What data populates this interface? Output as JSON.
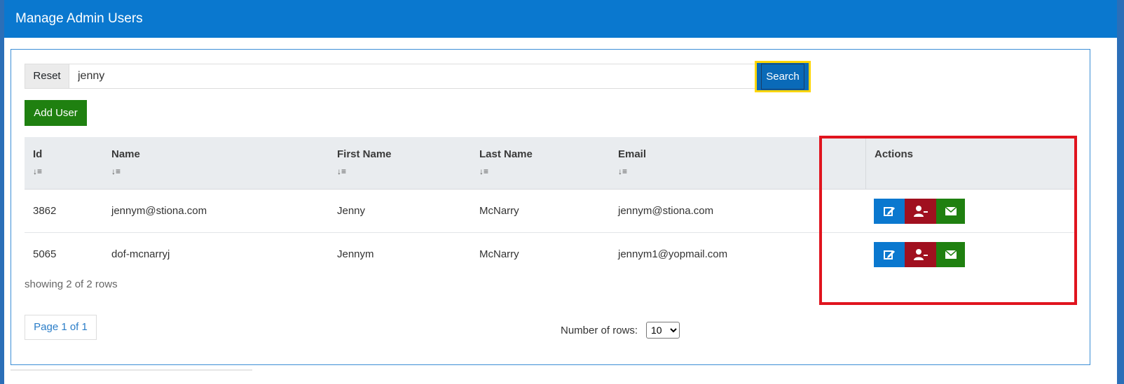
{
  "header": {
    "title": "Manage Admin Users"
  },
  "search": {
    "reset_label": "Reset",
    "query": "jenny",
    "button_label": "Search"
  },
  "toolbar": {
    "add_user_label": "Add User"
  },
  "table": {
    "columns": [
      "Id",
      "Name",
      "First Name",
      "Last Name",
      "Email",
      "Actions"
    ],
    "sort_icon": "↓≡",
    "rows": [
      {
        "id": "3862",
        "name": "jennym@stiona.com",
        "first_name": "Jenny",
        "last_name": "McNarry",
        "email": "jennym@stiona.com"
      },
      {
        "id": "5065",
        "name": "dof-mcnarryj",
        "first_name": "Jennym",
        "last_name": "McNarry",
        "email": "jennym1@yopmail.com"
      }
    ],
    "action_icons": [
      "edit-icon",
      "remove-user-icon",
      "envelope-icon"
    ]
  },
  "footer": {
    "showing": "showing 2 of 2 rows",
    "page": "Page 1 of 1",
    "rows_label": "Number of rows:",
    "rows_value": "10",
    "rows_options": [
      "10"
    ]
  },
  "colors": {
    "header": "#0a78cf",
    "edit": "#0a78cf",
    "remove": "#a0101f",
    "mail": "#1f8010",
    "highlight": "#e0141e",
    "focus": "#ffd500"
  }
}
